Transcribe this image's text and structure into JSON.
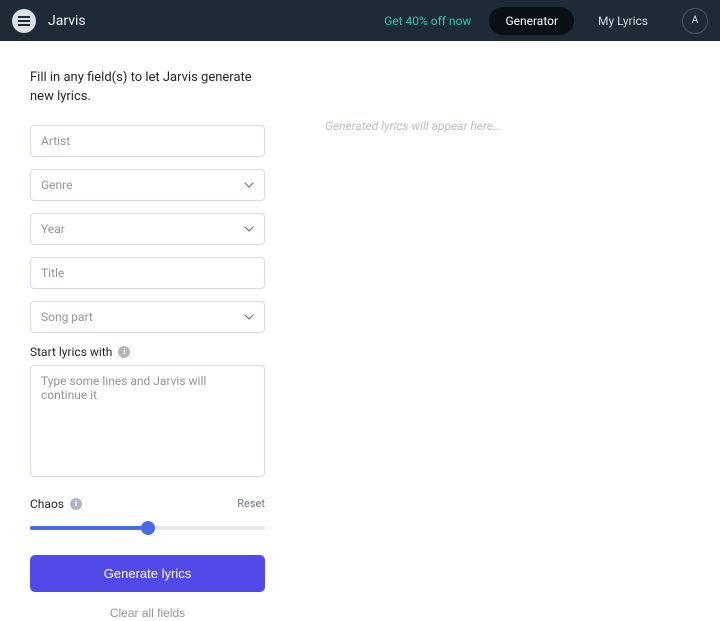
{
  "header": {
    "brand": "Jarvis",
    "promo": "Get 40% off now",
    "nav": {
      "generator": "Generator",
      "my_lyrics": "My Lyrics"
    },
    "avatar_initial": "A"
  },
  "form": {
    "intro": "Fill in any field(s) to let Jarvis generate new lyrics.",
    "artist_placeholder": "Artist",
    "genre_placeholder": "Genre",
    "year_placeholder": "Year",
    "title_placeholder": "Title",
    "song_part_placeholder": "Song part",
    "start_label": "Start lyrics with",
    "start_placeholder": "Type some lines and Jarvis will continue it",
    "chaos_label": "Chaos",
    "chaos_reset": "Reset",
    "chaos_value_percent": 50,
    "generate_button": "Generate lyrics",
    "clear_button": "Clear all fields"
  },
  "output": {
    "placeholder": "Generated lyrics will appear here..."
  },
  "colors": {
    "header_bg": "#1f2a37",
    "accent": "#5149e8",
    "promo": "#2ec7a6"
  }
}
